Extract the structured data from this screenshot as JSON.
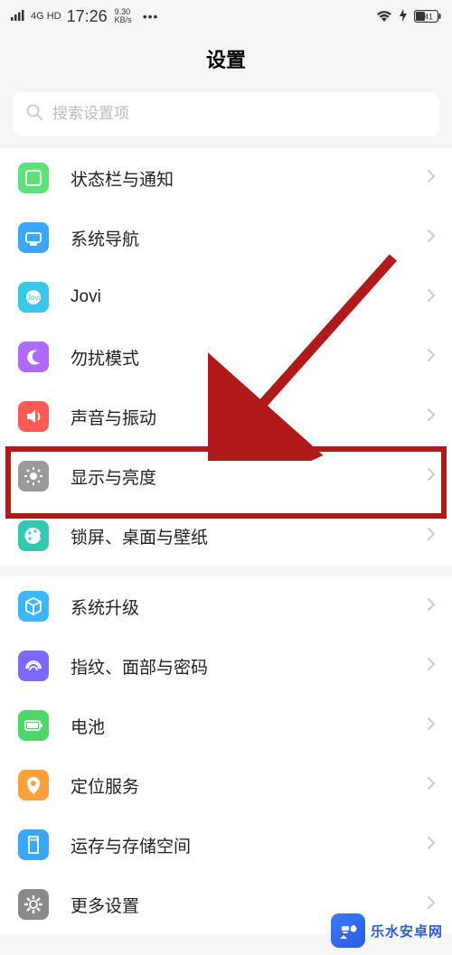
{
  "status_bar": {
    "network": "4G HD",
    "time": "17:26",
    "speed_top": "9.30",
    "speed_bottom": "KB/s",
    "battery_pct": "41"
  },
  "header": {
    "title": "设置"
  },
  "search": {
    "placeholder": "搜索设置项"
  },
  "groups": [
    {
      "rows": [
        {
          "key": "statusbar",
          "label": "状态栏与通知",
          "icon": "status-icon"
        },
        {
          "key": "navigation",
          "label": "系统导航",
          "icon": "nav-icon"
        },
        {
          "key": "jovi",
          "label": "Jovi",
          "icon": "jovi-icon"
        },
        {
          "key": "dnd",
          "label": "勿扰模式",
          "icon": "moon-icon"
        },
        {
          "key": "sound",
          "label": "声音与振动",
          "icon": "speaker-icon"
        },
        {
          "key": "display",
          "label": "显示与亮度",
          "icon": "brightness-icon",
          "highlight": true
        },
        {
          "key": "wallpaper",
          "label": "锁屏、桌面与壁纸",
          "icon": "palette-icon"
        }
      ]
    },
    {
      "rows": [
        {
          "key": "update",
          "label": "系统升级",
          "icon": "cube-icon"
        },
        {
          "key": "biometric",
          "label": "指纹、面部与密码",
          "icon": "fingerprint-icon"
        },
        {
          "key": "battery",
          "label": "电池",
          "icon": "battery-icon"
        },
        {
          "key": "location",
          "label": "定位服务",
          "icon": "location-icon"
        },
        {
          "key": "storage",
          "label": "运存与存储空间",
          "icon": "sdcard-icon"
        },
        {
          "key": "more",
          "label": "更多设置",
          "icon": "gear-icon"
        }
      ]
    }
  ],
  "watermark": {
    "text": "乐水安卓网"
  },
  "annotation": {
    "arrow_color": "#b11a1a"
  }
}
